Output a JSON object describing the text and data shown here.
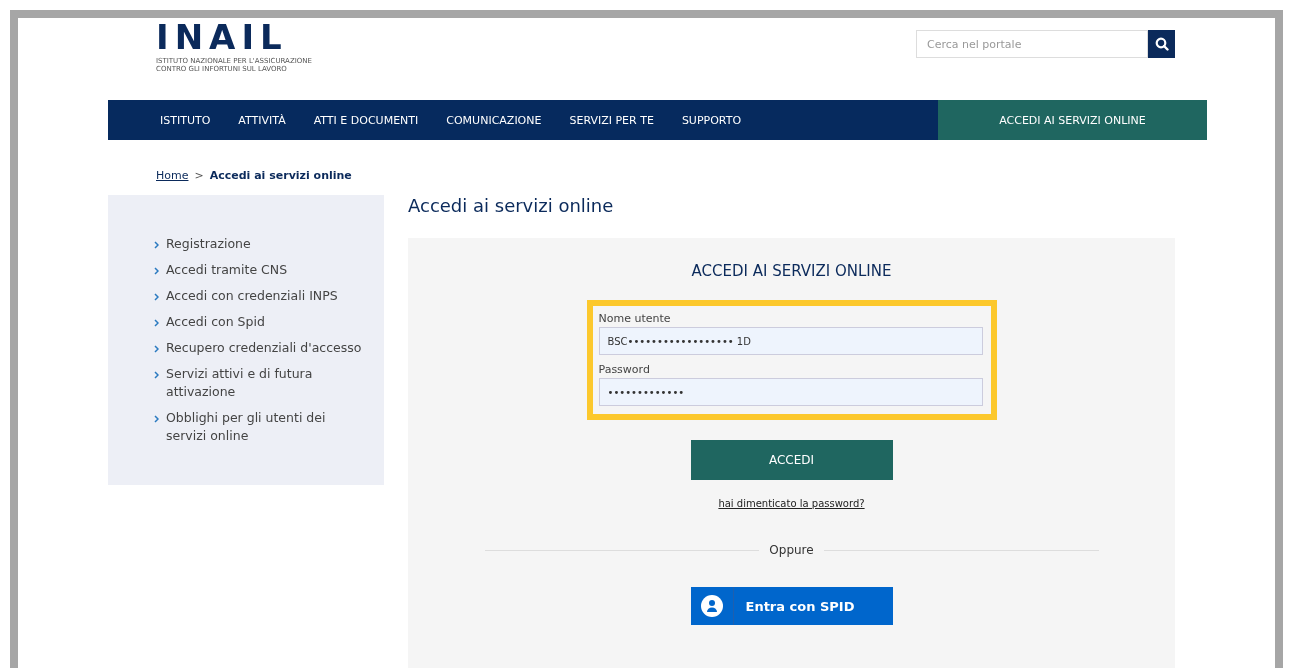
{
  "logo": {
    "name": "INAIL",
    "subtitle": [
      "ISTITUTO NAZIONALE PER L'ASSICURAZIONE",
      "CONTRO GLI INFORTUNI SUL LAVORO"
    ]
  },
  "search": {
    "placeholder": "Cerca nel portale"
  },
  "nav": {
    "items": [
      {
        "label": "ISTITUTO",
        "selected": false
      },
      {
        "label": "ATTIVITÀ",
        "selected": false
      },
      {
        "label": "ATTI E DOCUMENTI",
        "selected": false
      },
      {
        "label": "COMUNICAZIONE",
        "selected": false
      },
      {
        "label": "SERVIZI PER TE",
        "selected": false
      },
      {
        "label": "SUPPORTO",
        "selected": false
      }
    ],
    "cta": "ACCEDI AI SERVIZI ONLINE"
  },
  "breadcrumb": {
    "home": "Home",
    "separator": ">",
    "current": "Accedi ai servizi online"
  },
  "sidebar": {
    "items": [
      "Registrazione",
      "Accedi tramite CNS",
      "Accedi con credenziali INPS",
      "Accedi con Spid",
      "Recupero credenziali d'accesso",
      "Servizi attivi e di futura attivazione",
      "Obblighi per gli utenti dei servizi online"
    ]
  },
  "page_title": "Accedi ai servizi online",
  "login": {
    "heading": "ACCEDI AI SERVIZI ONLINE",
    "highlighted": true,
    "fields": [
      {
        "label": "Nome utente",
        "value": "BSC•••••••••••••••••• 1D"
      },
      {
        "label": "Password",
        "value": "•••••••••••••"
      }
    ],
    "submit": "ACCEDI",
    "forgot": "hai dimenticato la password?",
    "divider": "Oppure",
    "spid": "Entra con SPID"
  }
}
